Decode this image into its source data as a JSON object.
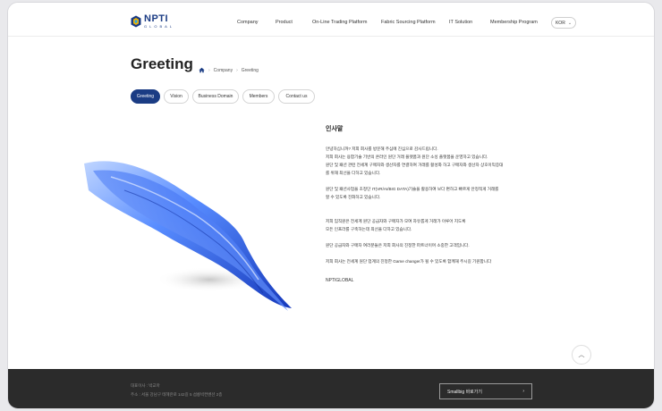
{
  "brand": {
    "name": "NPTI",
    "sub": "GLOBAL",
    "colors": {
      "primary": "#1b3c84",
      "footer_bg": "#2b2b2b"
    }
  },
  "nav": {
    "items": [
      "Company",
      "Product",
      "On-Line Trading Platform",
      "Fabric Sourcing Platform",
      "IT Solution",
      "Membership Program"
    ]
  },
  "lang": {
    "value": "KOR"
  },
  "page": {
    "title": "Greeting"
  },
  "breadcrumb": {
    "items": [
      "Company",
      "Greeting"
    ]
  },
  "tabs": [
    "Greeting",
    "Vision",
    "Business Domain",
    "Members",
    "Contact us"
  ],
  "content": {
    "heading": "인사말",
    "lines": [
      "안녕하십니까? 저희 회사를 방문해 주심에 진심으로 감사드립니다.",
      "저희 회사는 융합기술 기반의 온라인 원단 거래 플랫폼과 원단 소싱 플랫폼을 운영하고 있습니다.",
      "원단 및 패션 관련 전세계 구매자와 생산자를 연결하여 거래를 활성화 하고 구매자와 생산자 상호이익증대",
      "를 위해 최선을 다하고 있습니다.",
      "원단 및 패션사업을 초정단 IT(VR/AI/BIG DATA)기술을 활용하여 보다 편하고 빠르게 안정적게 거래를",
      "할 수 있도록 진화하고 있습니다.",
      "저희 임직원은 전세계 원단 공급자와 구매자가 모여 자유롭게 거래가 이루어 지도록",
      "모든 인프라를 구축하는데 최선을 다하고 있습니다.",
      "원단 공급자와 구매자 여러분들은  저희 회사의 진정한 파트너이며 소중한 고객입니다.",
      "저희 회사는 전세계 원단 업계의 진정한 Game changer가  될 수 있도록 함께해 주시길 기원합니다"
    ],
    "signature": "NPTIGLOBAL"
  },
  "footer": {
    "lines": [
      "대표이사 : 박교마",
      "주소 : 서울 강남구 테헤란로 142길 5 섬릉빅컨벤션 2층"
    ],
    "button_label": "Smallbig 바로가기"
  },
  "icons": {
    "top_button": "arrow-up-icon",
    "home": "home-icon",
    "chevron": "chevron-right-icon"
  }
}
